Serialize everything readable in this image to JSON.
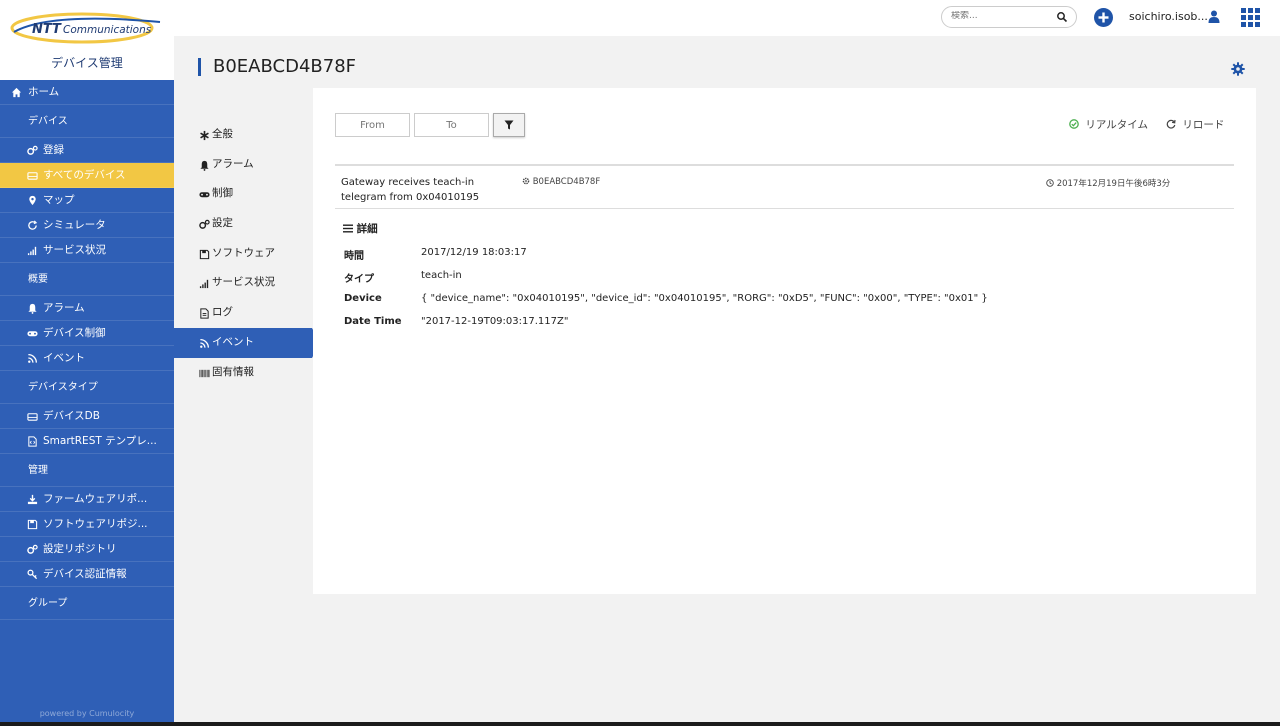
{
  "topbar": {
    "search_placeholder": "検索...",
    "user_name": "soichiro.isob..."
  },
  "brand": {
    "logo_text": "NTT Communications",
    "app_name": "デバイス管理"
  },
  "sidebar": {
    "home": "ホーム",
    "sections": {
      "devices": "デバイス",
      "overview": "概要",
      "device_types": "デバイスタイプ",
      "management": "管理",
      "groups": "グループ"
    },
    "device_items": [
      "登録",
      "すべてのデバイス",
      "マップ",
      "シミュレータ",
      "サービス状況"
    ],
    "overview_items": [
      "アラーム",
      "デバイス制御",
      "イベント"
    ],
    "device_type_items": [
      "デバイスDB",
      "SmartREST テンプレ..."
    ],
    "management_items": [
      "ファームウェアリポ...",
      "ソフトウェアリポジ...",
      "設定リポジトリ",
      "デバイス認証情報"
    ],
    "powered_by": "powered by Cumulocity"
  },
  "page": {
    "title": "B0EABCD4B78F"
  },
  "subnav": [
    "全般",
    "アラーム",
    "制御",
    "設定",
    "ソフトウェア",
    "サービス状況",
    "ログ",
    "イベント",
    "固有情報"
  ],
  "filters": {
    "from_placeholder": "From",
    "to_placeholder": "To",
    "realtime_label": "リアルタイム",
    "reload_label": "リロード"
  },
  "event": {
    "text_line1": "Gateway receives teach-in",
    "text_line2": "telegram from 0x04010195",
    "source": "B0EABCD4B78F",
    "time": "2017年12月19日午後6時3分"
  },
  "details": {
    "title": "詳細",
    "rows": [
      {
        "key": "時間",
        "value": "2017/12/19 18:03:17"
      },
      {
        "key": "タイプ",
        "value": "teach-in"
      },
      {
        "key": "Device",
        "value": "{ \"device_name\": \"0x04010195\", \"device_id\": \"0x04010195\", \"RORG\": \"0xD5\", \"FUNC\": \"0x00\", \"TYPE\": \"0x01\" }"
      },
      {
        "key": "Date Time",
        "value": "\"2017-12-19T09:03:17.117Z\""
      }
    ]
  },
  "colors": {
    "sidebar_bg": "#2f5fb6",
    "active_nav": "#f2c744",
    "accent": "#1f54a8",
    "realtime_ok": "#4caf50"
  }
}
